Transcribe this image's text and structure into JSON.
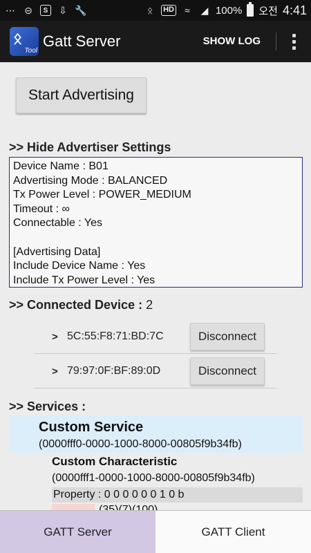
{
  "status_bar": {
    "battery": "100%",
    "ampm": "오전",
    "time": "4:41",
    "hd": "HD"
  },
  "action_bar": {
    "title": "Gatt Server",
    "icon_text": "Tool",
    "show_log": "SHOW LOG"
  },
  "advertising": {
    "start_button": "Start Advertising",
    "settings_title": ">> Hide Advertiser Settings",
    "settings_lines": [
      "Device Name : B01",
      "Advertising Mode : BALANCED",
      "Tx Power Level : POWER_MEDIUM",
      "Timeout : ∞",
      "Connectable : Yes",
      "",
      "[Advertising Data]",
      "Include Device Name : Yes",
      "Include Tx Power Level : Yes"
    ]
  },
  "connected": {
    "title": ">> Connected Device :",
    "count": "2",
    "devices": [
      {
        "arrow": ">",
        "address": "5C:55:F8:71:BD:7C",
        "button": "Disconnect"
      },
      {
        "arrow": ">",
        "address": "79:97:0F:BF:89:0D",
        "button": "Disconnect"
      }
    ]
  },
  "services": {
    "title": ">> Services :",
    "service_name": "Custom Service",
    "service_uuid": "(0000fff0-0000-1000-8000-00805f9b34fb)",
    "characteristic_name": "Custom Characteristic",
    "characteristic_uuid": "(0000fff1-0000-1000-8000-00805f9b34fb)",
    "property": "Property :  0 0 0 0 0 0 1 0 b",
    "permission_partial": "(35)(7)(100)"
  },
  "tabs": {
    "server": "GATT Server",
    "client": "GATT Client"
  }
}
